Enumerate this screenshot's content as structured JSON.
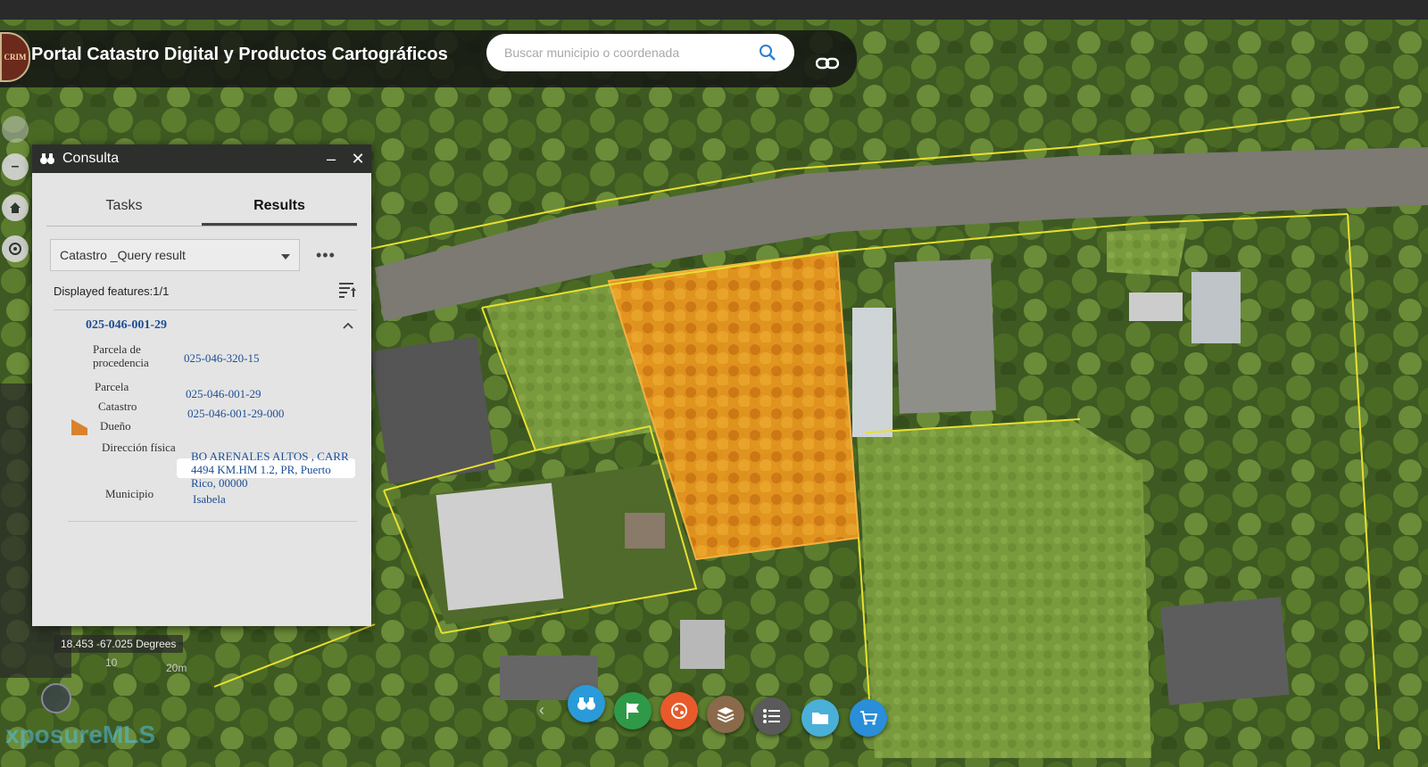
{
  "app": {
    "title": "Portal Catastro Digital y Productos Cartográficos",
    "logo_text": "CRIM"
  },
  "search": {
    "placeholder": "Buscar municipio o coordenada",
    "icon": "search-icon"
  },
  "header_actions": {
    "link_icon": "link-icon"
  },
  "map_controls": {
    "zoom_out": "–",
    "home_icon": "home-icon",
    "locate_icon": "locate-icon"
  },
  "panel": {
    "title": "Consulta",
    "minimize": "–",
    "close": "✕",
    "tabs": [
      {
        "label": "Tasks",
        "active": false
      },
      {
        "label": "Results",
        "active": true
      }
    ],
    "layer_select": "Catastro _Query result",
    "more": "•••",
    "displayed_features": "Displayed features:1/1",
    "feature": {
      "id": "025-046-001-29",
      "swatch_color": "#d9822b",
      "attributes": [
        {
          "key": "Parcela de procedencia",
          "value": "025-046-320-15"
        },
        {
          "key": "Parcela",
          "value": "025-046-001-29"
        },
        {
          "key": "Catastro",
          "value": "025-046-001-29-000"
        },
        {
          "key": "Dueño",
          "value": ""
        },
        {
          "key": "Dirección física",
          "value": "BO ARENALES ALTOS , CARR 4494 KM.HM 1.2, PR, Puerto Rico, 00000"
        },
        {
          "key": "Municipio",
          "value": "Isabela"
        }
      ]
    }
  },
  "map": {
    "coordinates": "18.453 -67.025 Degrees",
    "scale_a": "10",
    "scale_b": "20m",
    "highlight_color": "#f0a020",
    "parcel_line_color": "#e8e030"
  },
  "toolbar": {
    "prev": "‹",
    "buttons": [
      {
        "name": "query-icon",
        "color": "#2a9bd8"
      },
      {
        "name": "flag-icon",
        "color": "#2e9a48"
      },
      {
        "name": "analysis-icon",
        "color": "#e85a2a"
      },
      {
        "name": "layers-icon",
        "color": "#8a6a4a"
      },
      {
        "name": "legend-icon",
        "color": "#5a5a5a"
      },
      {
        "name": "folder-icon",
        "color": "#4ab0d8"
      },
      {
        "name": "cart-icon",
        "color": "#2a8ed8"
      }
    ]
  },
  "watermark": "xposureMLS"
}
